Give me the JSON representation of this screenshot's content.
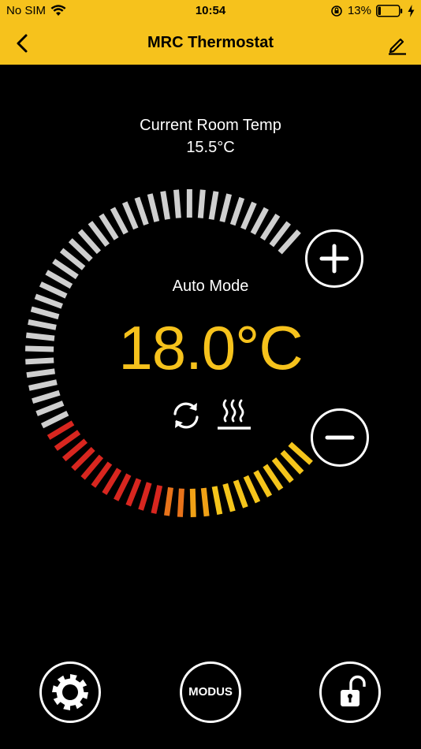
{
  "status_bar": {
    "carrier": "No SIM",
    "time": "10:54",
    "battery_percent": "13%"
  },
  "nav": {
    "title": "MRC Thermostat"
  },
  "room": {
    "label": "Current Room Temp",
    "value": "15.5°C"
  },
  "thermostat": {
    "mode_label": "Auto Mode",
    "setpoint": "18.0°C",
    "modus_label": "MODUS"
  },
  "icons": {
    "back": "chevron-left-icon",
    "edit": "pencil-icon",
    "plus": "plus-icon",
    "minus": "minus-icon",
    "auto_cycle": "sync-icon",
    "heating": "heat-waves-icon",
    "settings": "gear-icon",
    "lock": "unlock-icon",
    "wifi": "wifi-icon",
    "battery": "battery-icon",
    "charging": "lightning-icon",
    "rotation_lock": "rotation-lock-icon"
  },
  "colors": {
    "accent": "#f6c21c",
    "background": "#000000",
    "tick_inactive": "#cfcfcf",
    "tick_red": "#d8261f",
    "tick_orange": "#e8731a",
    "tick_yellow": "#f5c51b"
  }
}
